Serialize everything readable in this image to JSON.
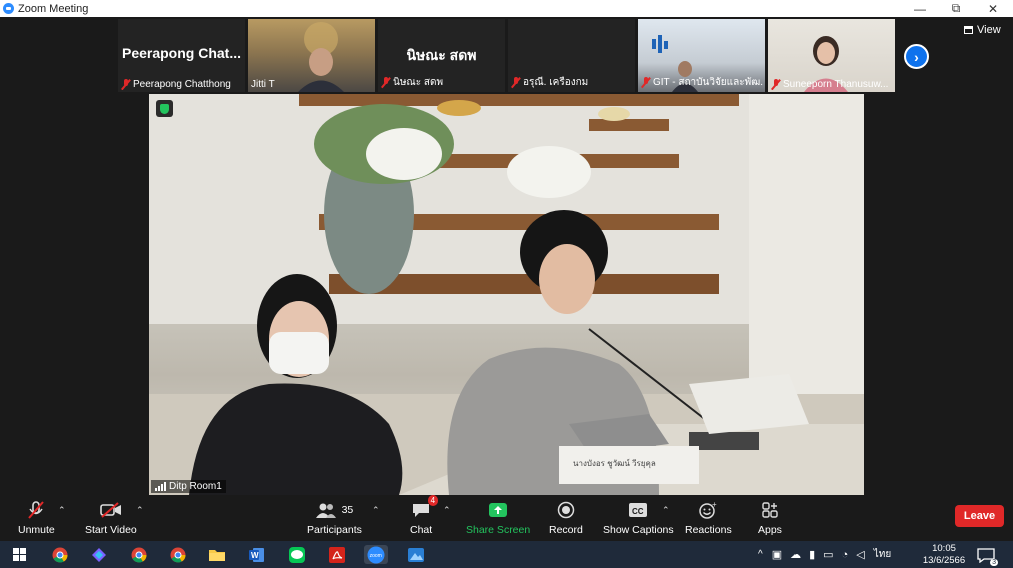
{
  "window": {
    "title": "Zoom Meeting",
    "minimize": "—",
    "restore": "⧉",
    "close": "✕"
  },
  "gallery": {
    "view_label": "View",
    "next_icon": "chevron-right-icon",
    "tiles": [
      {
        "big_name": "Peerapong  Chat...",
        "label": "Peerapong Chatthong",
        "muted": true,
        "has_video": false
      },
      {
        "big_name": "",
        "label": "Jitti T",
        "muted": false,
        "has_video": true
      },
      {
        "big_name": "นิษณะ สดพ",
        "label": "นิษณะ สดพ",
        "muted": true,
        "has_video": false
      },
      {
        "big_name": "",
        "label": "อรุณี. เครืองกม",
        "muted": true,
        "has_video": false
      },
      {
        "big_name": "",
        "label": "GIT - สถาบันวิจัยและพัฒ...",
        "muted": true,
        "has_video": true
      },
      {
        "big_name": "",
        "label": "Suneeporn Thanusuw...",
        "muted": true,
        "has_video": true
      }
    ]
  },
  "main_video": {
    "speaker_label": "Ditp Room1",
    "nameplate": "นางบังอร ชูวัฒน์ วีรยุคุล"
  },
  "toolbar": {
    "unmute": "Unmute",
    "start_video": "Start Video",
    "participants": "Participants",
    "participants_count": "35",
    "chat": "Chat",
    "chat_badge": "4",
    "share_screen": "Share Screen",
    "record": "Record",
    "show_captions": "Show Captions",
    "reactions": "Reactions",
    "apps": "Apps",
    "leave": "Leave"
  },
  "taskbar": {
    "time": "10:05",
    "date": "13/6/2566",
    "language": "ไทย",
    "notifications": "3",
    "zoom_label": "zoom"
  },
  "colors": {
    "accent": "#0e72ed",
    "leave": "#e02828",
    "share": "#23c45e"
  }
}
